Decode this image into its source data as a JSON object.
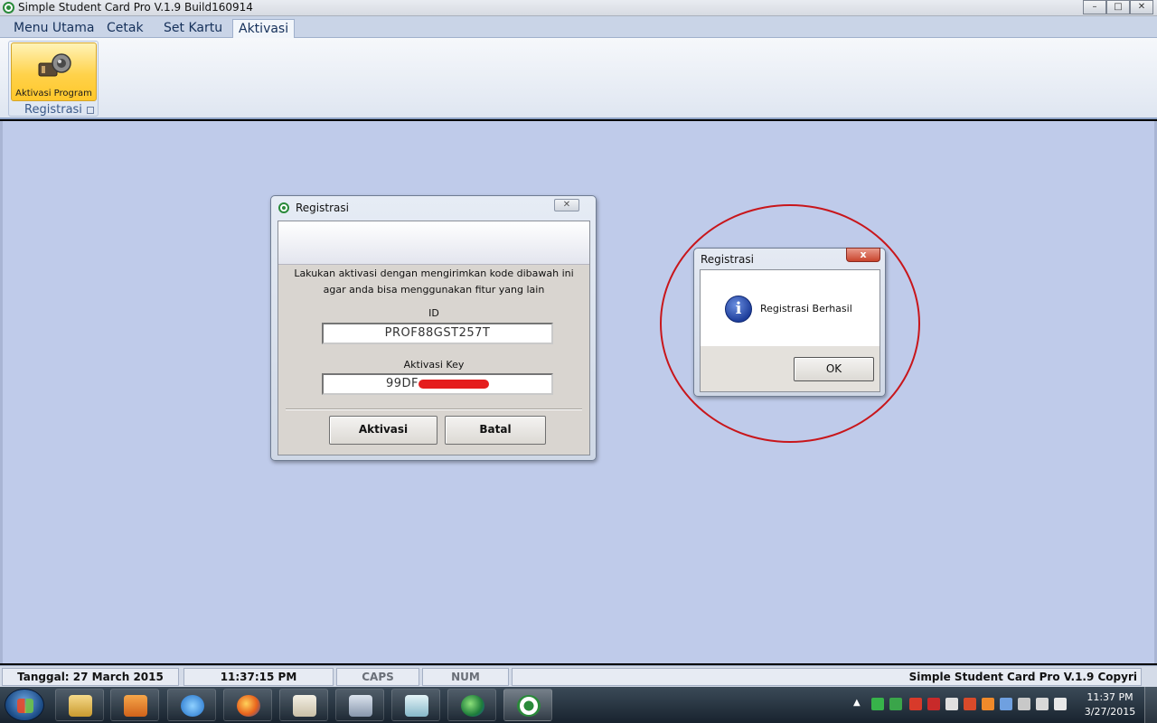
{
  "window": {
    "title": "Simple Student Card Pro V.1.9  Build160914",
    "minimize": "–",
    "maximize": "□",
    "close": "✕"
  },
  "ribbon": {
    "tabs": [
      "Menu Utama",
      "Cetak",
      "Set Kartu",
      "Aktivasi"
    ],
    "active_tab": "Aktivasi",
    "group_label": "Registrasi",
    "button_label": "Aktivasi Program",
    "button_icon": "key-lock-icon"
  },
  "dialog_registrasi": {
    "title": "Registrasi",
    "message_line1": "Lakukan aktivasi dengan mengirimkan kode dibawah ini",
    "message_line2": "agar anda bisa menggunakan fitur yang lain",
    "id_label": "ID",
    "id_value": "PROF88GST257T",
    "key_label": "Aktivasi Key",
    "key_value": "99DF",
    "btn_aktivasi": "Aktivasi",
    "btn_batal": "Batal",
    "close_glyph": "✕"
  },
  "message_box": {
    "title": "Registrasi",
    "text": "Registrasi Berhasil",
    "ok": "OK",
    "icon": "info-icon",
    "close_glyph": "x"
  },
  "statusbar": {
    "date": "Tanggal: 27 March 2015",
    "time": "11:37:15 PM",
    "caps": "CAPS",
    "num": "NUM",
    "app": "Simple Student Card Pro V.1.9 Copyri"
  },
  "taskbar": {
    "clock_time": "11:37 PM",
    "clock_date": "3/27/2015"
  },
  "colors": {
    "workspace": "#bfcbea",
    "highlight_circle": "#c8161b",
    "ribbon_button": "#ffd24a"
  }
}
